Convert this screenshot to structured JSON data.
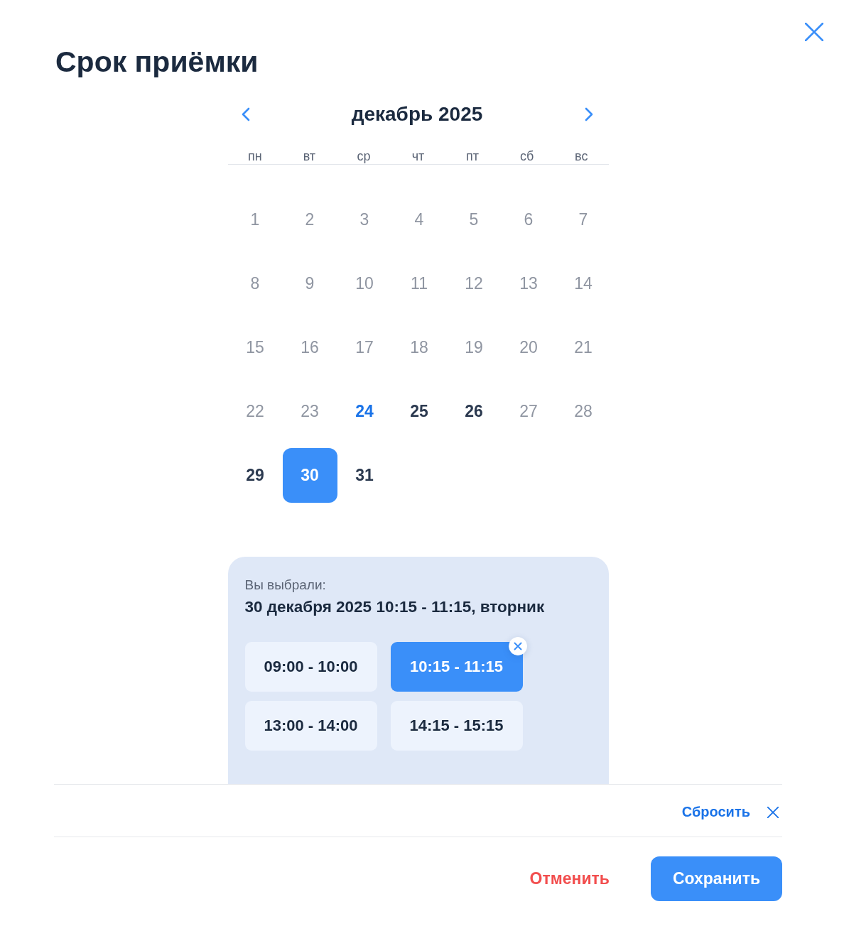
{
  "dialog": {
    "title": "Срок приёмки"
  },
  "calendar": {
    "month": "декабрь 2025",
    "weekdays": [
      "пн",
      "вт",
      "ср",
      "чт",
      "пт",
      "сб",
      "вс"
    ],
    "days": [
      {
        "label": "1",
        "disabled": true,
        "today": false,
        "selected": false
      },
      {
        "label": "2",
        "disabled": true,
        "today": false,
        "selected": false
      },
      {
        "label": "3",
        "disabled": true,
        "today": false,
        "selected": false
      },
      {
        "label": "4",
        "disabled": true,
        "today": false,
        "selected": false
      },
      {
        "label": "5",
        "disabled": true,
        "today": false,
        "selected": false
      },
      {
        "label": "6",
        "disabled": true,
        "today": false,
        "selected": false
      },
      {
        "label": "7",
        "disabled": true,
        "today": false,
        "selected": false
      },
      {
        "label": "8",
        "disabled": true,
        "today": false,
        "selected": false
      },
      {
        "label": "9",
        "disabled": true,
        "today": false,
        "selected": false
      },
      {
        "label": "10",
        "disabled": true,
        "today": false,
        "selected": false
      },
      {
        "label": "11",
        "disabled": true,
        "today": false,
        "selected": false
      },
      {
        "label": "12",
        "disabled": true,
        "today": false,
        "selected": false
      },
      {
        "label": "13",
        "disabled": true,
        "today": false,
        "selected": false
      },
      {
        "label": "14",
        "disabled": true,
        "today": false,
        "selected": false
      },
      {
        "label": "15",
        "disabled": true,
        "today": false,
        "selected": false
      },
      {
        "label": "16",
        "disabled": true,
        "today": false,
        "selected": false
      },
      {
        "label": "17",
        "disabled": true,
        "today": false,
        "selected": false
      },
      {
        "label": "18",
        "disabled": true,
        "today": false,
        "selected": false
      },
      {
        "label": "19",
        "disabled": true,
        "today": false,
        "selected": false
      },
      {
        "label": "20",
        "disabled": true,
        "today": false,
        "selected": false
      },
      {
        "label": "21",
        "disabled": true,
        "today": false,
        "selected": false
      },
      {
        "label": "22",
        "disabled": true,
        "today": false,
        "selected": false
      },
      {
        "label": "23",
        "disabled": true,
        "today": false,
        "selected": false
      },
      {
        "label": "24",
        "disabled": false,
        "today": true,
        "selected": false
      },
      {
        "label": "25",
        "disabled": false,
        "today": false,
        "selected": false
      },
      {
        "label": "26",
        "disabled": false,
        "today": false,
        "selected": false
      },
      {
        "label": "27",
        "disabled": true,
        "today": false,
        "selected": false
      },
      {
        "label": "28",
        "disabled": true,
        "today": false,
        "selected": false
      },
      {
        "label": "29",
        "disabled": false,
        "today": false,
        "selected": false
      },
      {
        "label": "30",
        "disabled": false,
        "today": false,
        "selected": true
      },
      {
        "label": "31",
        "disabled": false,
        "today": false,
        "selected": false
      }
    ]
  },
  "selection": {
    "caption": "Вы выбрали:",
    "summary": "30 декабря 2025 10:15 - 11:15, вторник",
    "slots": [
      {
        "label": "09:00 - 10:00",
        "selected": false
      },
      {
        "label": "10:15 - 11:15",
        "selected": true
      },
      {
        "label": "13:00 - 14:00",
        "selected": false
      },
      {
        "label": "14:15 - 15:15",
        "selected": false
      }
    ]
  },
  "footer": {
    "reset": "Сбросить",
    "cancel": "Отменить",
    "save": "Сохранить"
  }
}
